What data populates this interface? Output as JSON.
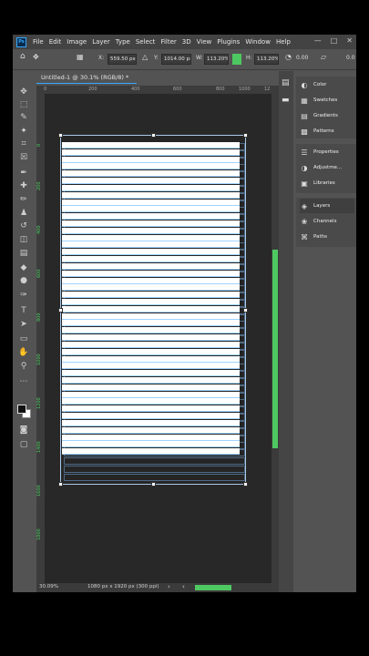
{
  "menubar": {
    "logo": "Ps",
    "items": [
      "File",
      "Edit",
      "Image",
      "Layer",
      "Type",
      "Select",
      "Filter",
      "3D",
      "View",
      "Plugins",
      "Window",
      "Help"
    ],
    "controls": [
      "—",
      "□",
      "✕"
    ]
  },
  "options": {
    "x_label": "X:",
    "x_value": "559.50 px",
    "y_label": "Y:",
    "y_value": "1014.00 px",
    "w_label": "W:",
    "w_value": "113.20%",
    "h_label": "H:",
    "h_value": "113.20%",
    "angle_value": "0.00",
    "extra": "0.0"
  },
  "document": {
    "tab_title": "Untitled-1 @ 30.1% (RGB/8) *",
    "status_zoom": "30.09%",
    "status_info": "1080 px x 1920 px (300 ppi)",
    "stripe_count": 44
  },
  "rulers": {
    "h_ticks": [
      "0",
      "200",
      "400",
      "600",
      "800",
      "1000",
      "12"
    ],
    "v_ticks": [
      "0",
      "200",
      "400",
      "600",
      "800",
      "1000",
      "1200",
      "1400",
      "1600",
      "1800"
    ]
  },
  "tools": [
    {
      "icon": "move-icon",
      "glyph": "✥"
    },
    {
      "icon": "marquee-icon",
      "glyph": "⬚"
    },
    {
      "icon": "lasso-icon",
      "glyph": "✎"
    },
    {
      "icon": "quick-select-icon",
      "glyph": "✦"
    },
    {
      "icon": "crop-icon",
      "glyph": "⌗"
    },
    {
      "icon": "frame-icon",
      "glyph": "☒"
    },
    {
      "icon": "eyedropper-icon",
      "glyph": "✒"
    },
    {
      "icon": "healing-icon",
      "glyph": "✚"
    },
    {
      "icon": "brush-icon",
      "glyph": "✏"
    },
    {
      "icon": "stamp-icon",
      "glyph": "♟"
    },
    {
      "icon": "history-brush-icon",
      "glyph": "↺"
    },
    {
      "icon": "eraser-icon",
      "glyph": "◫"
    },
    {
      "icon": "gradient-icon",
      "glyph": "▤"
    },
    {
      "icon": "blur-icon",
      "glyph": "◆"
    },
    {
      "icon": "dodge-icon",
      "glyph": "●"
    },
    {
      "icon": "pen-icon",
      "glyph": "✑"
    },
    {
      "icon": "type-icon",
      "glyph": "T"
    },
    {
      "icon": "path-select-icon",
      "glyph": "➤"
    },
    {
      "icon": "rectangle-icon",
      "glyph": "▭"
    },
    {
      "icon": "hand-icon",
      "glyph": "✋"
    },
    {
      "icon": "zoom-icon",
      "glyph": "⚲"
    },
    {
      "icon": "more-tools-icon",
      "glyph": "⋯"
    }
  ],
  "panels": {
    "group1": [
      {
        "label": "Color",
        "icon": "color-icon",
        "glyph": "◐"
      },
      {
        "label": "Swatches",
        "icon": "swatches-icon",
        "glyph": "▦"
      },
      {
        "label": "Gradients",
        "icon": "gradients-icon",
        "glyph": "▤"
      },
      {
        "label": "Patterns",
        "icon": "patterns-icon",
        "glyph": "▩"
      }
    ],
    "group2": [
      {
        "label": "Properties",
        "icon": "properties-icon",
        "glyph": "☰"
      },
      {
        "label": "Adjustme...",
        "icon": "adjustments-icon",
        "glyph": "◑"
      },
      {
        "label": "Libraries",
        "icon": "libraries-icon",
        "glyph": "▣"
      }
    ],
    "group3": [
      {
        "label": "Layers",
        "icon": "layers-icon",
        "glyph": "◈"
      },
      {
        "label": "Channels",
        "icon": "channels-icon",
        "glyph": "❀"
      },
      {
        "label": "Paths",
        "icon": "paths-icon",
        "glyph": "⌘"
      }
    ]
  },
  "colors": {
    "accent": "#4ec961",
    "ui_bg": "#535353",
    "canvas": "#282828",
    "stripe": "#ffffff"
  }
}
